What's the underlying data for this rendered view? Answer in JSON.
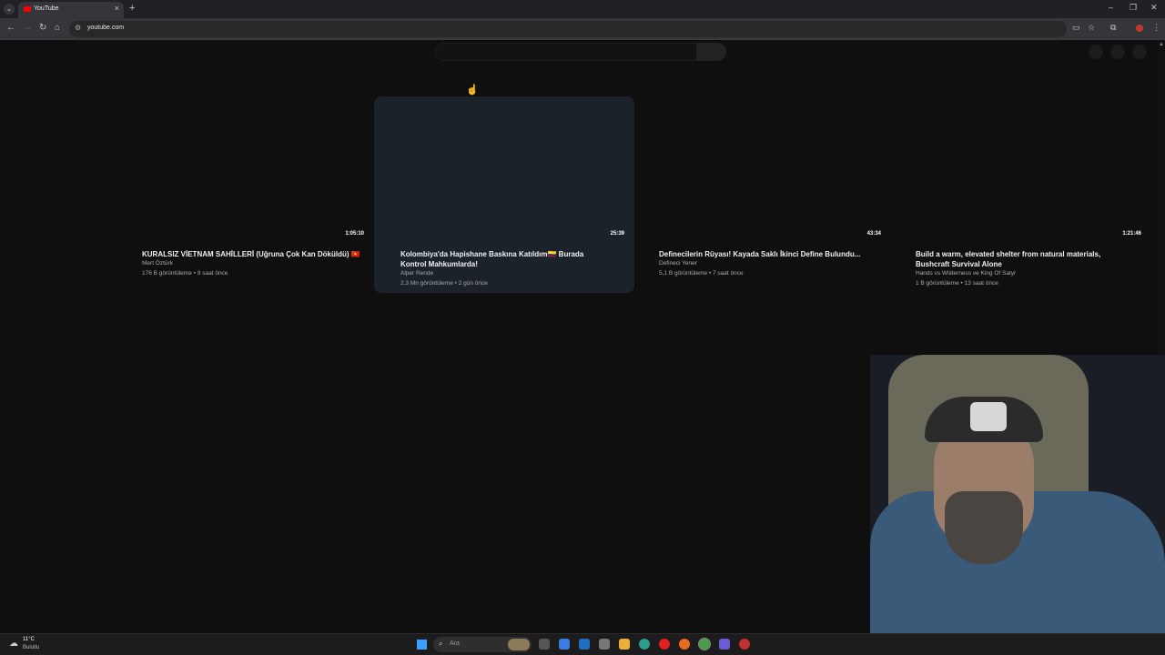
{
  "browser": {
    "tab_title": "YouTube",
    "tab_close": "×",
    "new_tab": "+",
    "url": "youtube.com",
    "back": "←",
    "forward": "→",
    "reload": "↻",
    "home": "⌂",
    "minimize": "–",
    "restore": "❐",
    "close": "✕"
  },
  "videos": [
    {
      "title": "KURALSIZ VİETNAM SAHİLLERİ (Uğruna Çok Kan Döküldü) 🇻🇳",
      "channel": "Mert Öztürk",
      "meta": "176 B görüntüleme • 9 saat önce",
      "duration": "1:05:10"
    },
    {
      "title": "Kolombiya'da Hapishane Baskına Katıldım🇨🇴 Burada Kontrol Mahkumlarda!",
      "channel": "Alper Rende",
      "meta": "2,3 Mn görüntüleme • 2 gün önce",
      "duration": "25:39"
    },
    {
      "title": "Definecilerin Rüyası! Kayada Saklı İkinci Define Bulundu...",
      "channel": "Defineci Yener",
      "meta": "5,1 B görüntüleme • 7 saat önce",
      "duration": "43:34"
    },
    {
      "title": "Build a warm, elevated shelter from natural materials, Bushcraft Survival Alone",
      "channel": "Hands vs Wilderness ve King Of Satyr",
      "meta": "1 B görüntüleme • 13 saat önce",
      "duration": "1:21:46"
    }
  ],
  "taskbar": {
    "temperature": "11°C",
    "weather": "Bulutlu",
    "search_placeholder": "Ara"
  },
  "colors": {
    "page_bg": "#0f0f0f",
    "hover_card": "#1b222a",
    "accent": "#ff0000"
  }
}
